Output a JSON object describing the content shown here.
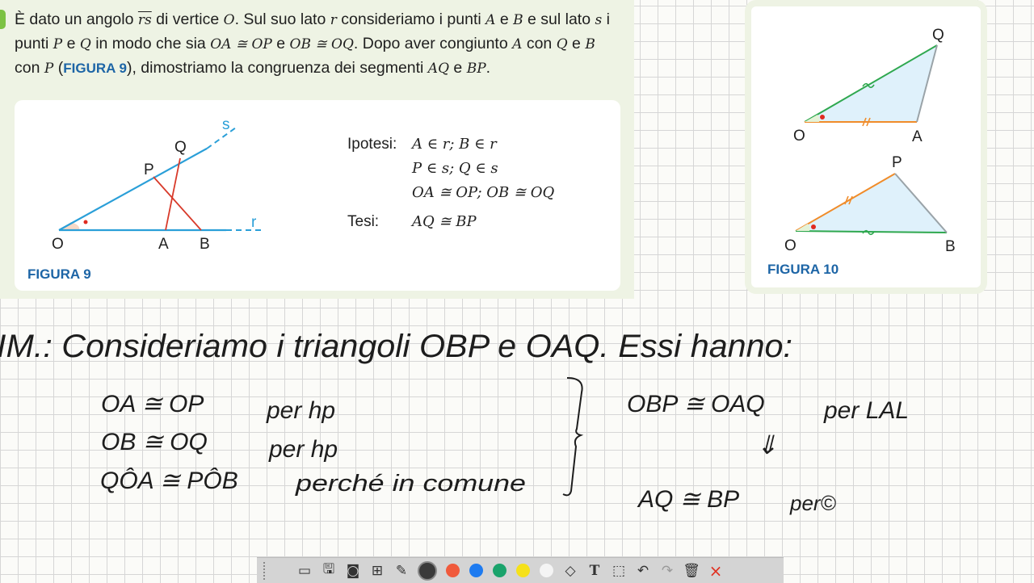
{
  "problem": {
    "line1_a": "È dato un angolo ",
    "angle": "rs",
    "line1_b": " di vertice ",
    "vertex": "O",
    "line1_c": ". Sul suo lato ",
    "r": "r",
    "line1_d": " consideriamo i punti ",
    "A": "A",
    "e1": " e ",
    "B": "B",
    "line1_e": " e sul lato ",
    "s": "s",
    "line1_f": " i",
    "line2_a": "punti ",
    "P": "P",
    "e2": " e ",
    "Q": "Q",
    "line2_b": " in modo che sia ",
    "c1": "OA ≅ OP",
    "e3": " e ",
    "c2": "OB ≅ OQ",
    "line2_c": ". Dopo aver congiunto ",
    "A2": "A",
    "line2_d": " con ",
    "Q2": "Q",
    "e4": " e ",
    "B2": "B",
    "line3_a": "con ",
    "P2": "P",
    "line3_b": " (",
    "fig_ref": "FIGURA 9",
    "line3_c": "), dimostriamo la congruenza dei segmenti ",
    "AQ": "AQ",
    "e5": " e ",
    "BP": "BP",
    "line3_d": "."
  },
  "figure9": {
    "caption": "FIGURA 9",
    "labels": {
      "O": "O",
      "A": "A",
      "B": "B",
      "P": "P",
      "Q": "Q",
      "r": "r",
      "s": "s"
    }
  },
  "hypothesis": {
    "ipotesi_label": "Ipotesi:",
    "tesi_label": "Tesi:",
    "rows": [
      "A ∈ r; B ∈ r",
      "P ∈ s; Q ∈ s",
      "OA ≅ OP; OB ≅ OQ"
    ],
    "thesis": "AQ ≅ BP"
  },
  "figure10": {
    "caption": "FIGURA 10",
    "top_labels": {
      "O": "O",
      "A": "A",
      "Q": "Q"
    },
    "bottom_labels": {
      "O": "O",
      "B": "B",
      "P": "P"
    }
  },
  "handwriting": {
    "title_line": "IM.: Consideriamo i triangoli OBP e OAQ. Essi hanno:",
    "row1_left": "OA ≅ OP",
    "row1_reason": "per hp",
    "row2_left": "OB ≅ OQ",
    "row2_reason": "per hp",
    "row3_left": "QÔA ≅ PÔB",
    "row3_reason": "perché in comune",
    "result": "OBP ≅ OAQ",
    "result_reason": "per LAL",
    "implies": "⇓",
    "conclusion": "AQ ≅ BP",
    "conclusion_reason": "per©"
  },
  "toolbar": {
    "tools": [
      "screen-icon",
      "save-icon",
      "camera-icon",
      "toolbox-icon",
      "pen-icon",
      "color-dark",
      "color-red",
      "color-blue",
      "color-green",
      "color-yellow",
      "color-white",
      "eraser-icon",
      "text-icon",
      "select-icon",
      "undo-icon",
      "redo-icon",
      "trash-icon",
      "close-icon"
    ],
    "text_tool": "T",
    "close": "×",
    "colors": {
      "dark": "#3a3a3a",
      "red": "#f05a3c",
      "blue": "#1e7bf0",
      "green": "#1aa36b",
      "yellow": "#f5e11a",
      "white": "#f4f4f4"
    }
  }
}
